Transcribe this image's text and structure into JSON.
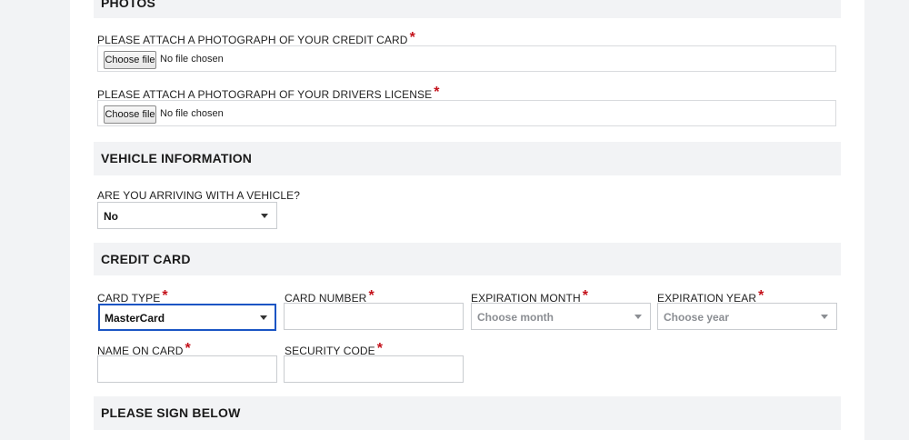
{
  "sections": {
    "photos": "PHOTOS",
    "vehicle": "VEHICLE INFORMATION",
    "credit_card": "CREDIT CARD",
    "sign": "PLEASE SIGN BELOW"
  },
  "photos": {
    "credit_card_label": "PLEASE ATTACH A PHOTOGRAPH OF YOUR CREDIT CARD",
    "license_label": "PLEASE ATTACH A PHOTOGRAPH OF YOUR DRIVERS LICENSE",
    "choose_file": "Choose file",
    "no_file": "No file chosen"
  },
  "vehicle": {
    "question": "ARE YOU ARRIVING WITH A VEHICLE?",
    "value": "No"
  },
  "card": {
    "type_label": "CARD TYPE",
    "type_value": "MasterCard",
    "number_label": "CARD NUMBER",
    "number_value": "",
    "exp_month_label": "EXPIRATION MONTH",
    "exp_month_placeholder": "Choose month",
    "exp_year_label": "EXPIRATION YEAR",
    "exp_year_placeholder": "Choose year",
    "name_label": "NAME ON CARD",
    "name_value": "",
    "security_label": "SECURITY CODE",
    "security_value": ""
  },
  "required_mark": "*",
  "colors": {
    "required": "#c4121b",
    "focus_border": "#1a55c4",
    "section_bg": "#f2f3f5"
  }
}
